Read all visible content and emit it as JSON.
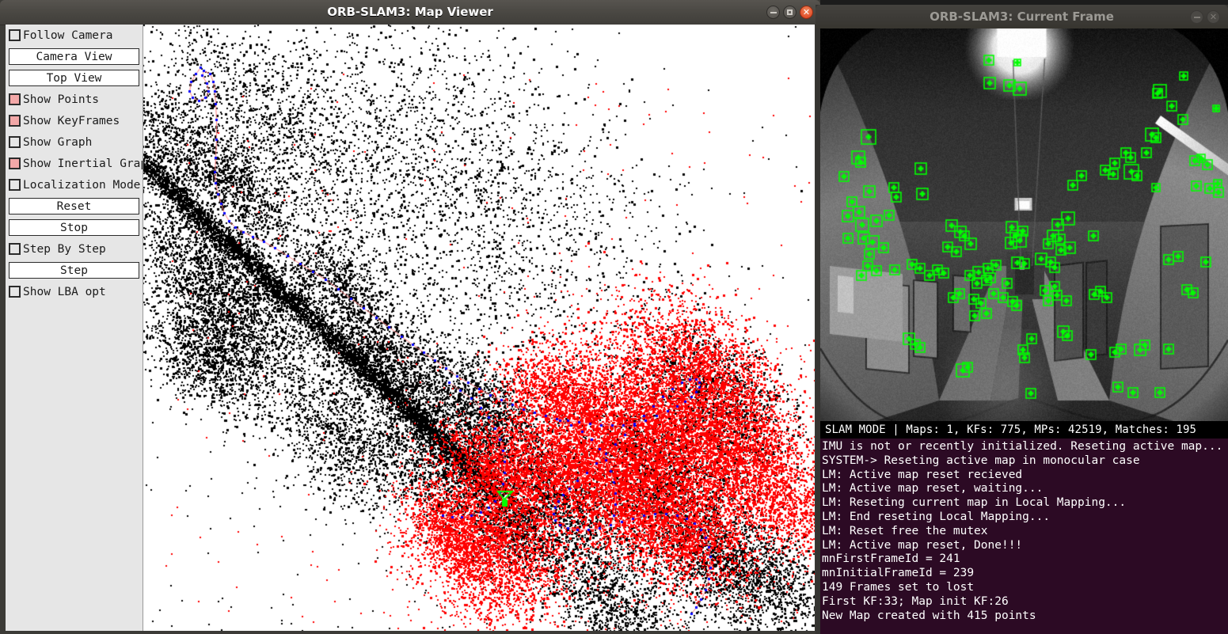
{
  "map_window": {
    "title": "ORB-SLAM3: Map Viewer",
    "controls": {
      "minimize": "minimize-button",
      "maximize": "maximize-button",
      "close": "close-button"
    },
    "panel": {
      "items": [
        {
          "type": "checkbox",
          "label": "Follow Camera",
          "checked": false
        },
        {
          "type": "button",
          "label": "Camera View"
        },
        {
          "type": "button",
          "label": "Top View"
        },
        {
          "type": "checkbox",
          "label": "Show Points",
          "checked": true
        },
        {
          "type": "checkbox",
          "label": "Show KeyFrames",
          "checked": true
        },
        {
          "type": "checkbox",
          "label": "Show Graph",
          "checked": false
        },
        {
          "type": "checkbox",
          "label": "Show Inertial Graph",
          "checked": true
        },
        {
          "type": "checkbox",
          "label": "Localization Mode",
          "checked": false
        },
        {
          "type": "button",
          "label": "Reset"
        },
        {
          "type": "button",
          "label": "Stop"
        },
        {
          "type": "checkbox",
          "label": "Step By Step",
          "checked": false
        },
        {
          "type": "button",
          "label": "Step"
        },
        {
          "type": "checkbox",
          "label": "Show LBA opt",
          "checked": false
        }
      ]
    },
    "map_colors": {
      "background": "#ffffff",
      "inactive_points": "#000000",
      "active_points": "#ff0000",
      "keyframes": "#0000ff",
      "graph_edges": "#ff8080",
      "current_camera": "#00ff00"
    }
  },
  "frame_window": {
    "title": "ORB-SLAM3: Current Frame",
    "controls": {
      "minimize": "minimize-button",
      "close": "close-button"
    },
    "feature_color": "#00ff00",
    "status": {
      "mode": "SLAM MODE",
      "separator": "|",
      "text": "SLAM MODE  |  Maps: 1, KFs: 775, MPs: 42519, Matches: 195",
      "maps": 1,
      "kfs": 775,
      "mps": 42519,
      "matches": 195
    },
    "terminal": {
      "background": "#2c0a24",
      "lines": [
        "IMU is not or recently initialized. Reseting active map...",
        "SYSTEM-> Reseting active map in monocular case",
        "LM: Active map reset recieved",
        "LM: Active map reset, waiting...",
        "LM: Reseting current map in Local Mapping...",
        "LM: End reseting Local Mapping...",
        "LM: Reset free the mutex",
        "LM: Active map reset, Done!!!",
        "mnFirstFrameId = 241",
        "mnInitialFrameId = 239",
        "149 Frames set to lost",
        "First KF:33; Map init KF:26",
        "New Map created with 415 points"
      ]
    }
  }
}
